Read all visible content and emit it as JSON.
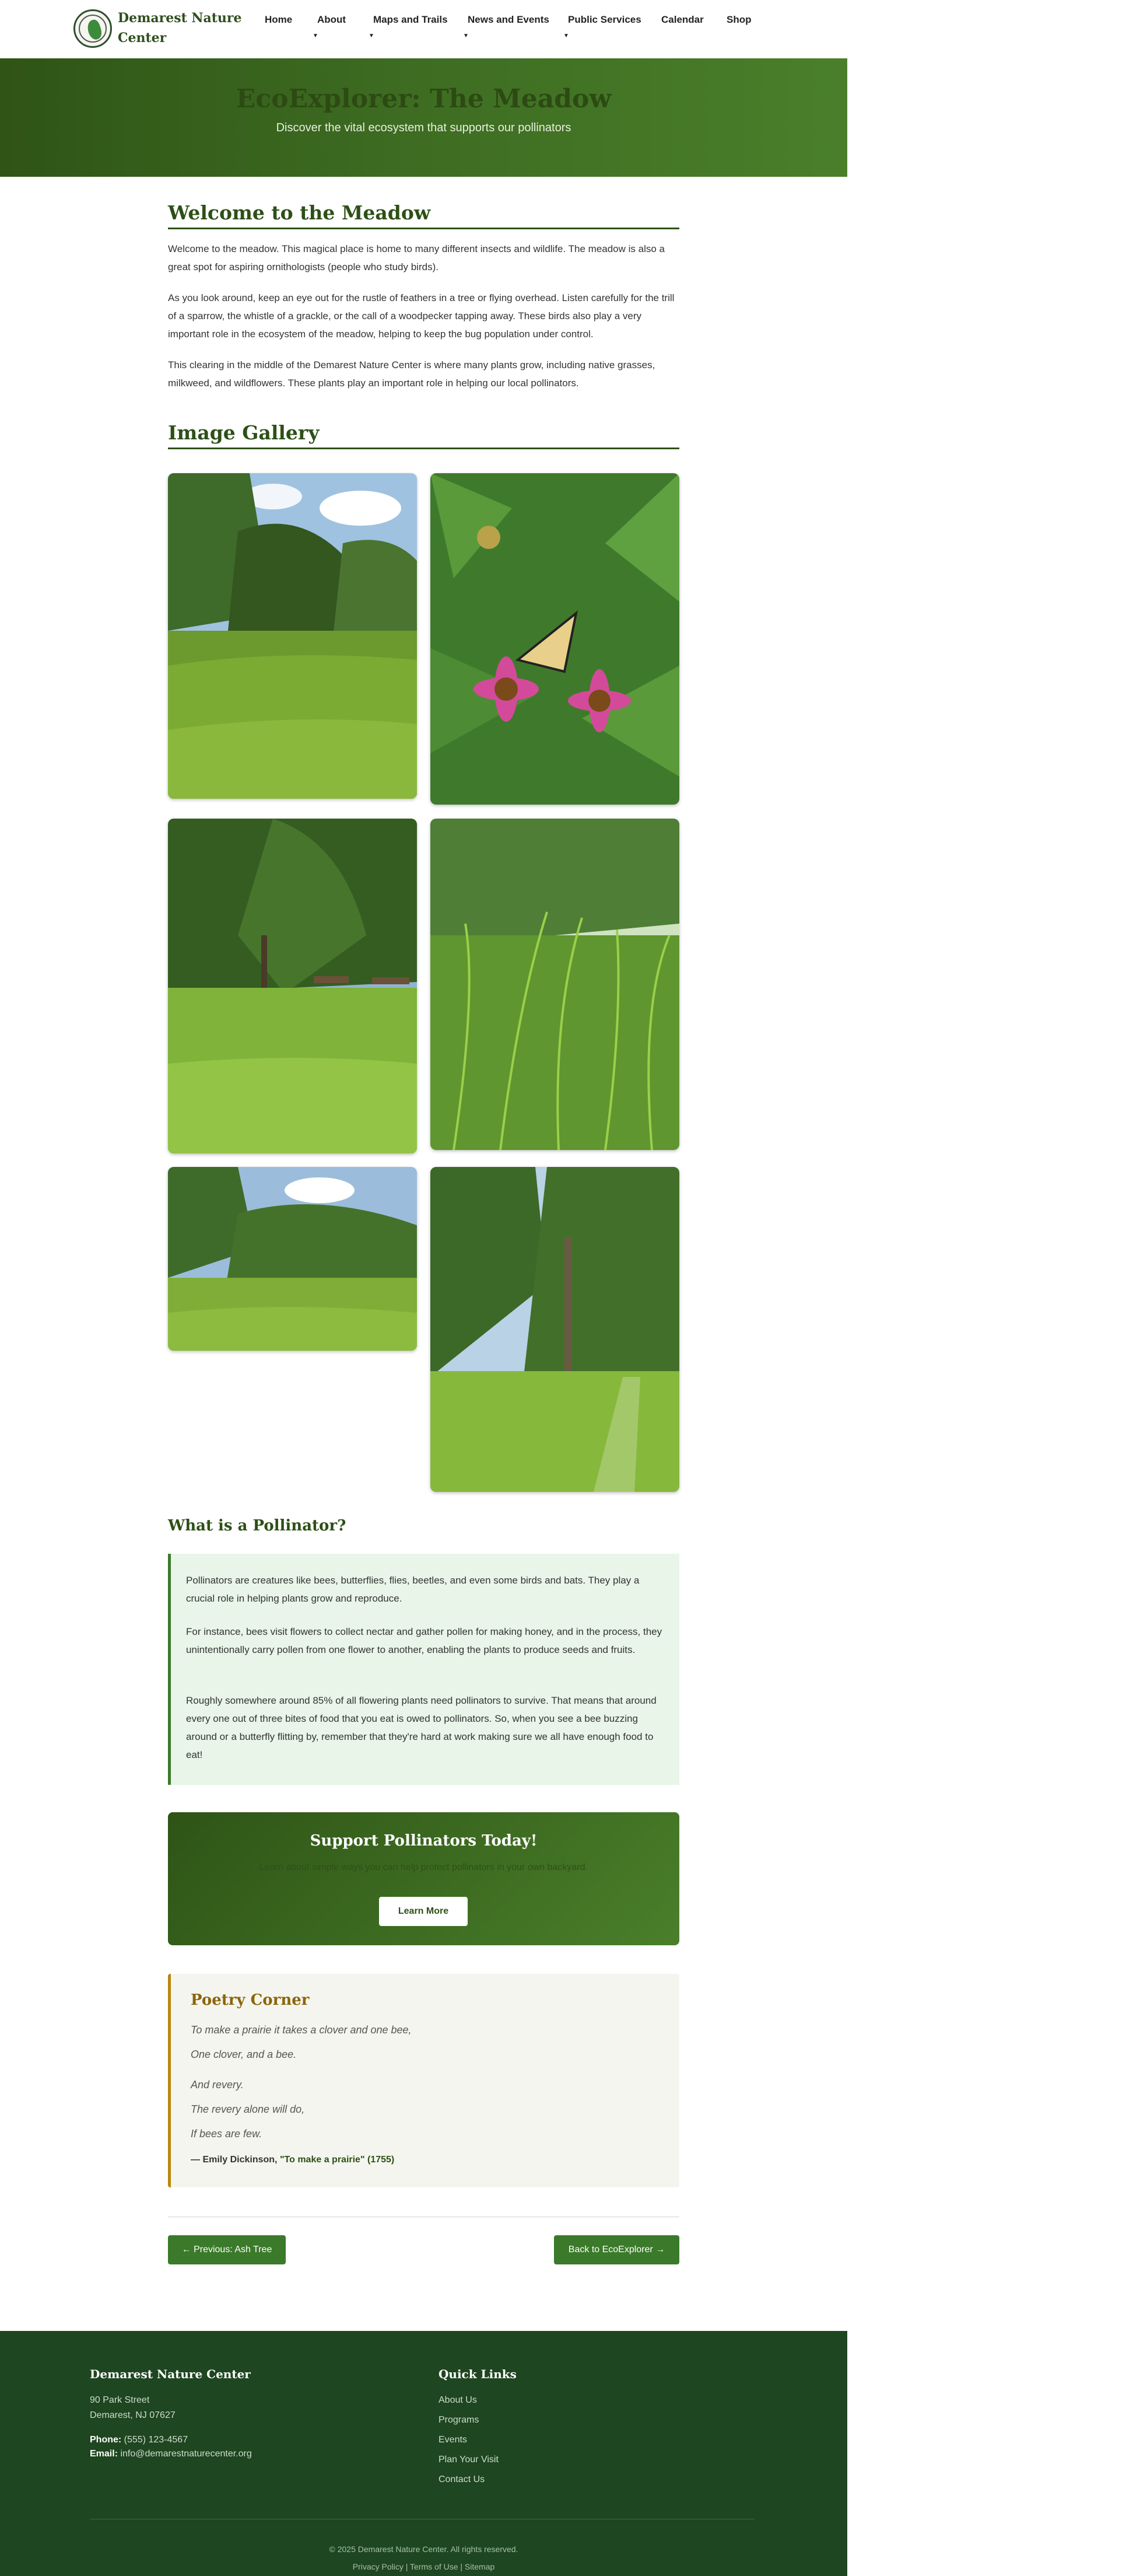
{
  "header": {
    "brand": "Demarest Nature Center",
    "nav": [
      {
        "label": "Home",
        "has_dropdown": false
      },
      {
        "label": "About",
        "has_dropdown": true
      },
      {
        "label": "Maps and Trails",
        "has_dropdown": true
      },
      {
        "label": "News and Events",
        "has_dropdown": true
      },
      {
        "label": "Public Services",
        "has_dropdown": true
      },
      {
        "label": "Calendar",
        "has_dropdown": false
      },
      {
        "label": "Shop",
        "has_dropdown": false
      }
    ]
  },
  "hero": {
    "title": "EcoExplorer: The Meadow",
    "subtitle": "Discover the vital ecosystem that supports our pollinators"
  },
  "welcome": {
    "heading": "Welcome to the Meadow",
    "paragraphs": [
      "Welcome to the meadow. This magical place is home to many different insects and wildlife. The meadow is also a great spot for aspiring ornithologists (people who study birds).",
      "As you look around, keep an eye out for the rustle of feathers in a tree or flying overhead. Listen carefully for the trill of a sparrow, the whistle of a grackle, or the call of a woodpecker tapping away. These birds also play a very important role in the ecosystem of the meadow, helping to keep the bug population under control.",
      "This clearing in the middle of the Demarest Nature Center is where many plants grow, including native grasses, milkweed, and wildflowers. These plants play an important role in helping our local pollinators."
    ]
  },
  "gallery": {
    "heading": "Image Gallery",
    "images": [
      {
        "name": "meadow-trees-photo"
      },
      {
        "name": "butterfly-coneflower-photo"
      },
      {
        "name": "park-benches-photo"
      },
      {
        "name": "tall-grass-photo"
      },
      {
        "name": "meadow-clearing-photo"
      },
      {
        "name": "trail-trees-photo"
      }
    ]
  },
  "pollinator": {
    "heading": "What is a Pollinator?",
    "paragraphs": [
      "Pollinators are creatures like bees, butterflies, flies, beetles, and even some birds and bats. They play a crucial role in helping plants grow and reproduce.",
      "For instance, bees visit flowers to collect nectar and gather pollen for making honey, and in the process, they unintentionally carry pollen from one flower to another, enabling the plants to produce seeds and fruits.",
      "Roughly somewhere around 85% of all flowering plants need pollinators to survive. That means that around every one out of three bites of food that you eat is owed to pollinators. So, when you see a bee buzzing around or a butterfly flitting by, remember that they're hard at work making sure we all have enough food to eat!"
    ]
  },
  "cta": {
    "heading": "Support Pollinators Today!",
    "text": "Learn about simple ways you can help protect pollinators in your own backyard.",
    "button": "Learn More"
  },
  "poetry": {
    "heading": "Poetry Corner",
    "lines": [
      "To make a prairie it takes a clover and one bee,",
      "One clover, and a bee.",
      "And revery.",
      "The revery alone will do,",
      "If bees are few."
    ],
    "author": "— Emily Dickinson,",
    "work": "\"To make a prairie\" (1755)"
  },
  "pager": {
    "prev": "← Previous: Ash Tree",
    "next": "Back to EcoExplorer →"
  },
  "footer": {
    "org_heading": "Demarest Nature Center",
    "address1": "90 Park Street",
    "address2": "Demarest, NJ 07627",
    "phone_label": "Phone:",
    "phone": "(555) 123-4567",
    "email_label": "Email:",
    "email": "info@demarestnaturecenter.org",
    "links_heading": "Quick Links",
    "links": [
      "About Us",
      "Programs",
      "Events",
      "Plan Your Visit",
      "Contact Us"
    ],
    "copyright": "© 2025 Demarest Nature Center. All rights reserved.",
    "legal": [
      "Privacy Policy",
      "Terms of Use",
      "Sitemap"
    ]
  },
  "colors": {
    "primary": "#2d5016",
    "accent": "#3a7a2a",
    "footer": "#1e4620",
    "poetry_border": "#b8860b",
    "info_bg": "#e8f5e8"
  }
}
